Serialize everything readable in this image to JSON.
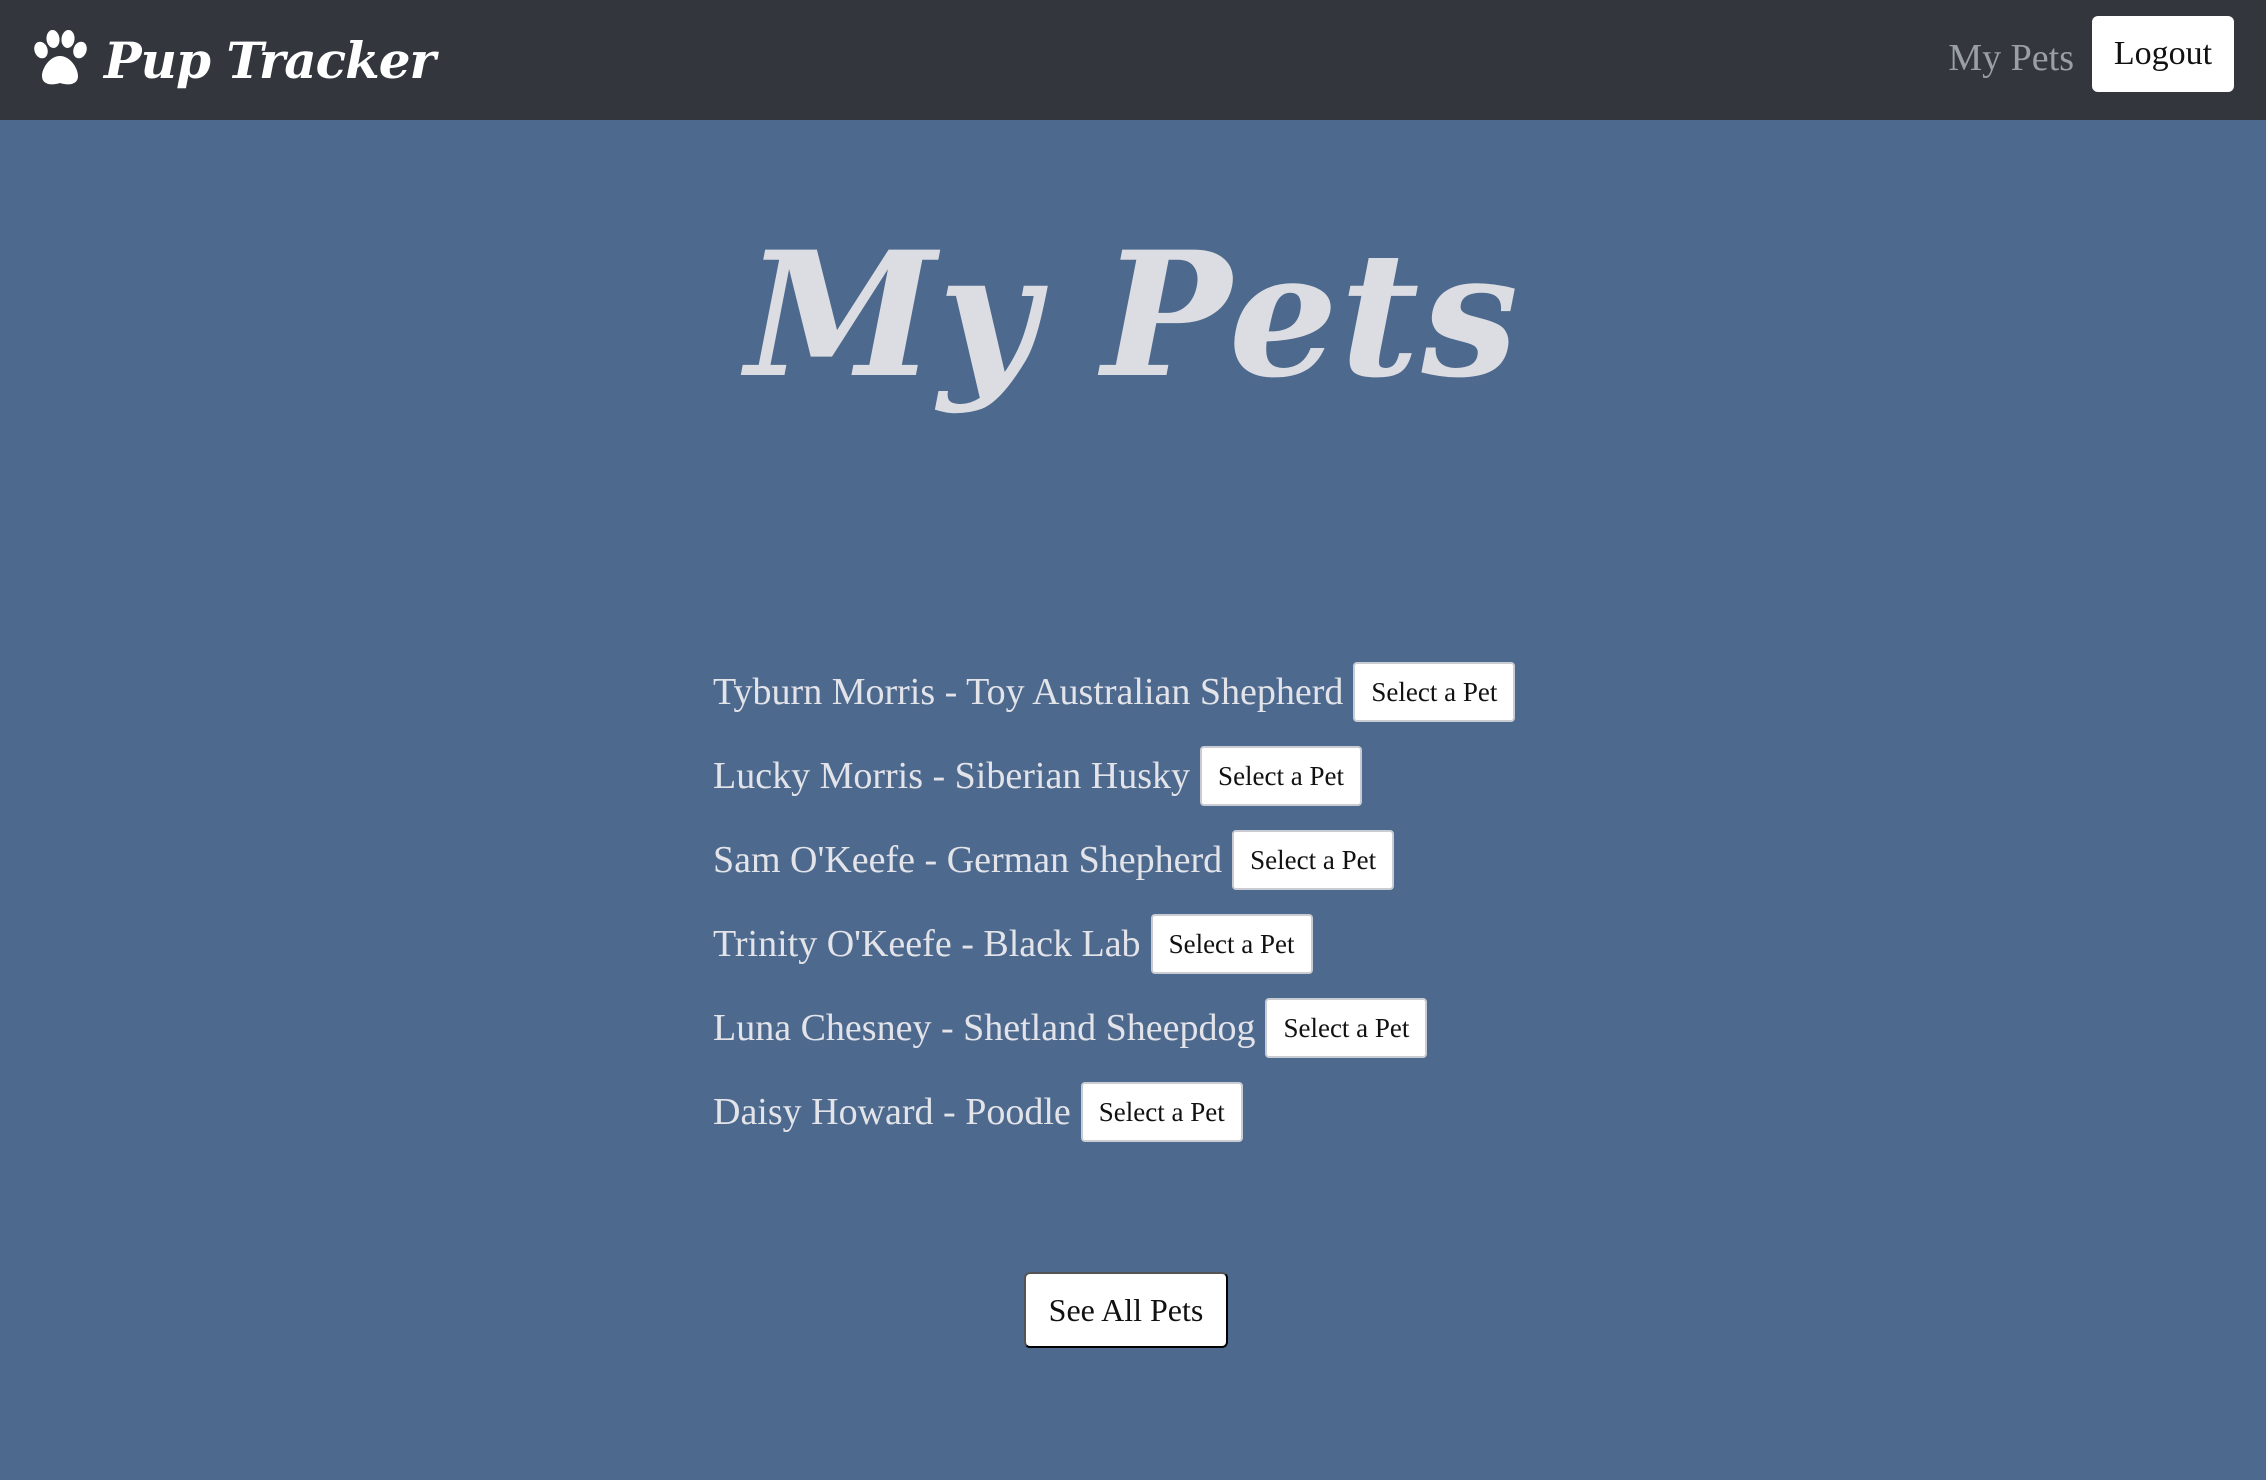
{
  "navbar": {
    "brand": "Pup Tracker",
    "brand_icon": "paw-icon",
    "my_pets_link": "My Pets",
    "logout_label": "Logout"
  },
  "main": {
    "title": "My Pets",
    "select_label": "Select a Pet",
    "pets": [
      {
        "label": "Tyburn Morris - Toy Australian Shepherd"
      },
      {
        "label": "Lucky Morris - Siberian Husky"
      },
      {
        "label": "Sam O'Keefe - German Shepherd"
      },
      {
        "label": "Trinity O'Keefe - Black Lab"
      },
      {
        "label": "Luna Chesney - Shetland Sheepdog"
      },
      {
        "label": "Daisy Howard - Poodle"
      }
    ],
    "see_all_label": "See All Pets"
  },
  "colors": {
    "navbar_bg": "#33373d",
    "page_bg": "#4d698d",
    "title_text": "#dcdde3",
    "button_bg": "#ffffff"
  }
}
